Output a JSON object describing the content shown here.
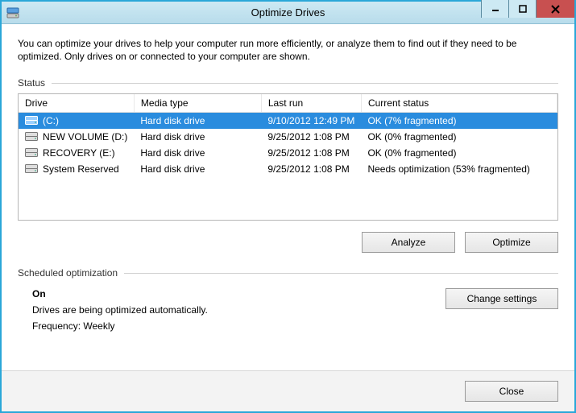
{
  "window": {
    "title": "Optimize Drives"
  },
  "intro": "You can optimize your drives to help your computer run more efficiently, or analyze them to find out if they need to be optimized. Only drives on or connected to your computer are shown.",
  "sections": {
    "status_label": "Status",
    "sched_label": "Scheduled optimization"
  },
  "columns": {
    "drive": "Drive",
    "media": "Media type",
    "last": "Last run",
    "status": "Current status"
  },
  "drives": [
    {
      "name": "(C:)",
      "media": "Hard disk drive",
      "last": "9/10/2012 12:49 PM",
      "status": "OK (7% fragmented)",
      "selected": true
    },
    {
      "name": "NEW VOLUME (D:)",
      "media": "Hard disk drive",
      "last": "9/25/2012 1:08 PM",
      "status": "OK (0% fragmented)",
      "selected": false
    },
    {
      "name": "RECOVERY (E:)",
      "media": "Hard disk drive",
      "last": "9/25/2012 1:08 PM",
      "status": "OK (0% fragmented)",
      "selected": false
    },
    {
      "name": "System Reserved",
      "media": "Hard disk drive",
      "last": "9/25/2012 1:08 PM",
      "status": "Needs optimization (53% fragmented)",
      "selected": false
    }
  ],
  "buttons": {
    "analyze": "Analyze",
    "optimize": "Optimize",
    "change_settings": "Change settings",
    "close": "Close"
  },
  "schedule": {
    "state": "On",
    "desc": "Drives are being optimized automatically.",
    "freq": "Frequency: Weekly"
  }
}
